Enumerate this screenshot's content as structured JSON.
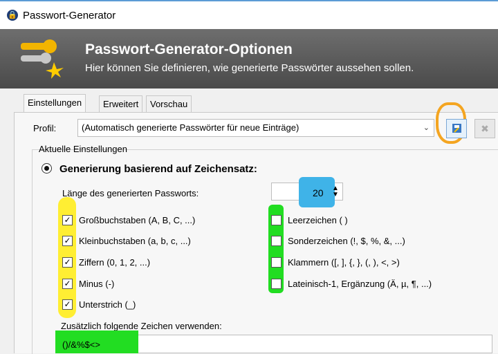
{
  "window": {
    "title": "Passwort-Generator",
    "icon": "lock-badge-icon"
  },
  "banner": {
    "title": "Passwort-Generator-Optionen",
    "subtitle": "Hier können Sie definieren, wie generierte Passwörter aussehen sollen.",
    "icon": "keys-icon"
  },
  "tabs": [
    {
      "label": "Einstellungen",
      "active": true
    },
    {
      "label": "Erweitert",
      "active": false
    },
    {
      "label": "Vorschau",
      "active": false
    }
  ],
  "profile": {
    "label": "Profil:",
    "selected": "(Automatisch generierte Passwörter für neue Einträge)",
    "save_icon": "save-profile-icon",
    "delete_icon": "delete-profile-icon"
  },
  "settings": {
    "group_label": "Aktuelle Einstellungen",
    "mode_label": "Generierung basierend auf Zeichensatz:",
    "length_label": "Länge des generierten Passworts:",
    "length_value": "20",
    "left_options": [
      {
        "label": "Großbuchstaben (A, B, C, ...)",
        "checked": true
      },
      {
        "label": "Kleinbuchstaben (a, b, c, ...)",
        "checked": true
      },
      {
        "label": "Ziffern (0, 1, 2, ...)",
        "checked": true
      },
      {
        "label": "Minus (-)",
        "checked": true
      },
      {
        "label": "Unterstrich (_)",
        "checked": true
      }
    ],
    "right_options": [
      {
        "label": "Leerzeichen ( )",
        "checked": false
      },
      {
        "label": "Sonderzeichen (!, $, %, &, ...)",
        "checked": false
      },
      {
        "label": "Klammern ([, ], {, }, (, ), <, >)",
        "checked": false
      },
      {
        "label": "Lateinisch-1, Ergänzung (Ä, µ, ¶, ...)",
        "checked": false
      }
    ],
    "extra_chars_label": "Zusätzlich folgende Zeichen verwenden:",
    "extra_chars_value": "()/&%$<>"
  },
  "colors": {
    "highlight_yellow": "#ffee33",
    "highlight_green": "#22dd22",
    "highlight_blue": "#3fb3e8",
    "highlight_orange": "#f4a521"
  }
}
